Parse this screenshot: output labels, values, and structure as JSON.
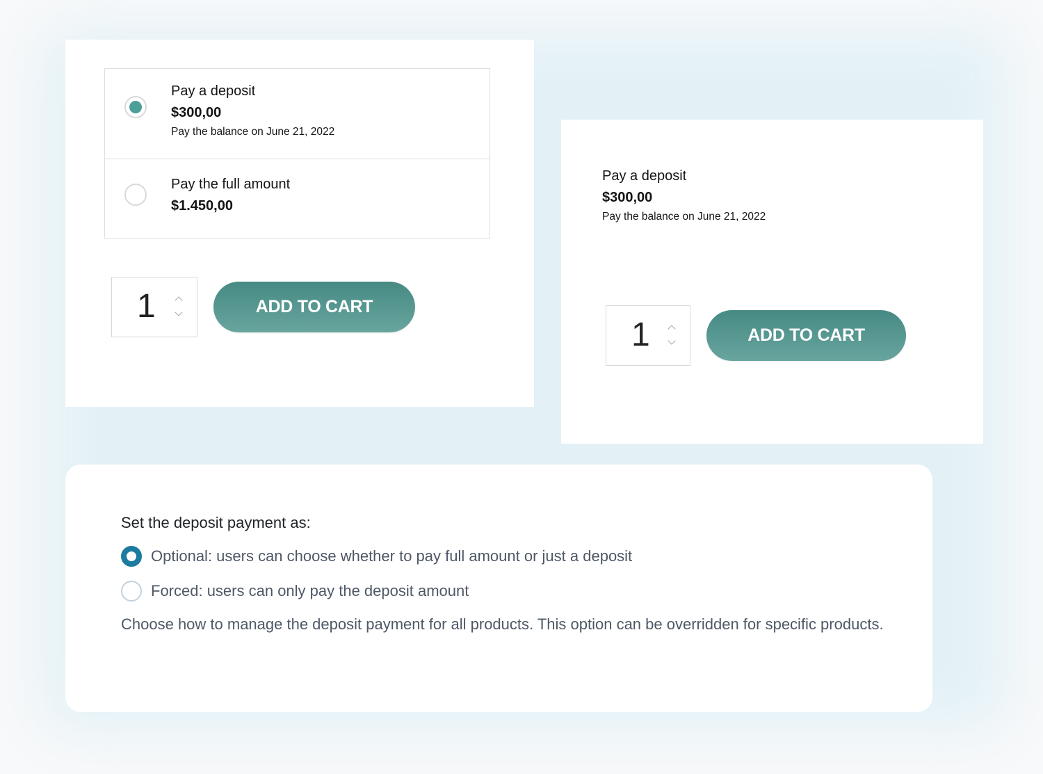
{
  "card_optional": {
    "options": [
      {
        "title": "Pay a deposit",
        "price": "$300,00",
        "note": "Pay the balance on June 21, 2022",
        "selected": true
      },
      {
        "title": "Pay the full amount",
        "price": "$1.450,00",
        "selected": false
      }
    ],
    "quantity": "1",
    "add_to_cart_label": "ADD TO CART"
  },
  "card_forced": {
    "title": "Pay a deposit",
    "price": "$300,00",
    "note": "Pay the balance on June 21, 2022",
    "quantity": "1",
    "add_to_cart_label": "ADD TO CART"
  },
  "settings": {
    "heading": "Set the deposit payment as:",
    "options": [
      {
        "label": "Optional: users can choose whether to pay full amount or just a deposit",
        "selected": true
      },
      {
        "label": "Forced: users can only pay the deposit amount",
        "selected": false
      }
    ],
    "description": "Choose how to manage the deposit payment for all products. This option can be overridden for specific products."
  },
  "colors": {
    "accent_teal": "#4c9f98",
    "button_gradient_top": "#468a83",
    "button_gradient_bottom": "#68a59f",
    "admin_radio_blue": "#1d7aa0",
    "glow": "#e3f1f7"
  }
}
